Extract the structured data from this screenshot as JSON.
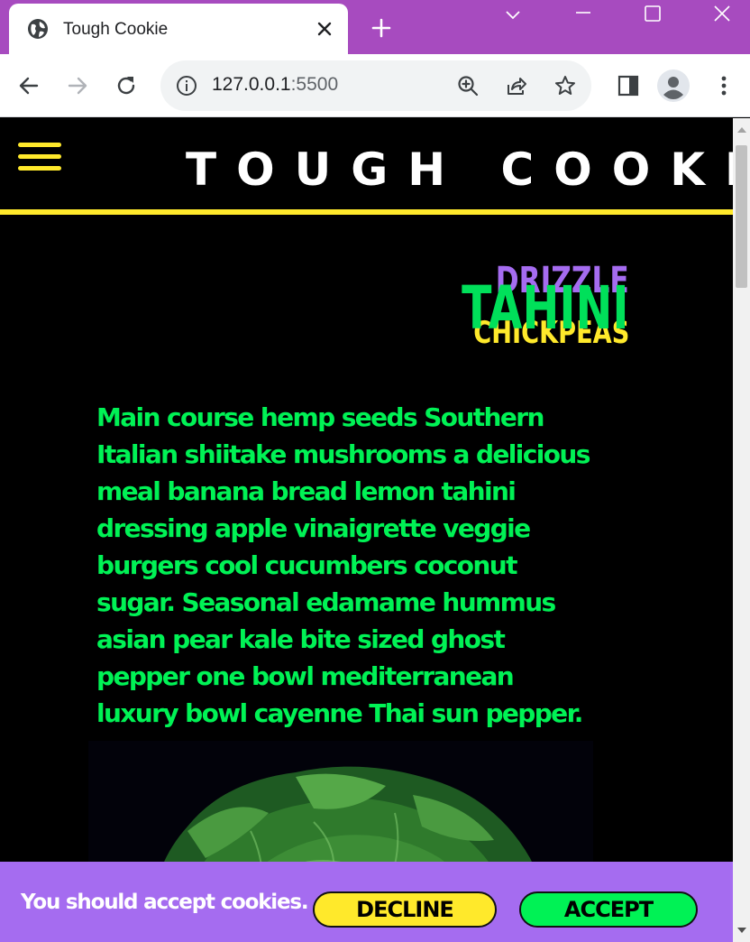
{
  "browser": {
    "tab_title": "Tough Cookie",
    "url_host": "127.0.0.1",
    "url_port": ":5500"
  },
  "site": {
    "title": "TOUGH COOKIE",
    "headline": {
      "top": "DRIZZLE",
      "middle": "TAHINI",
      "bottom": "CHICKPEAS"
    },
    "body_text": "Main course hemp seeds Southern Italian shiitake mushrooms a delicious meal banana bread lemon tahini dressing apple vinaigrette veggie burgers cool cucumbers coconut sugar. Seasonal edamame hummus asian pear kale bite sized ghost pepper one bowl mediterranean luxury bowl cayenne Thai sun pepper."
  },
  "cookie_banner": {
    "message": "You should accept cookies.",
    "decline_label": "DECLINE",
    "accept_label": "ACCEPT"
  },
  "colors": {
    "chrome_frame": "#a74bbf",
    "accent_yellow": "#ffe92b",
    "accent_green": "#00f255",
    "accent_purple": "#a56cf0",
    "page_background": "#000000"
  }
}
